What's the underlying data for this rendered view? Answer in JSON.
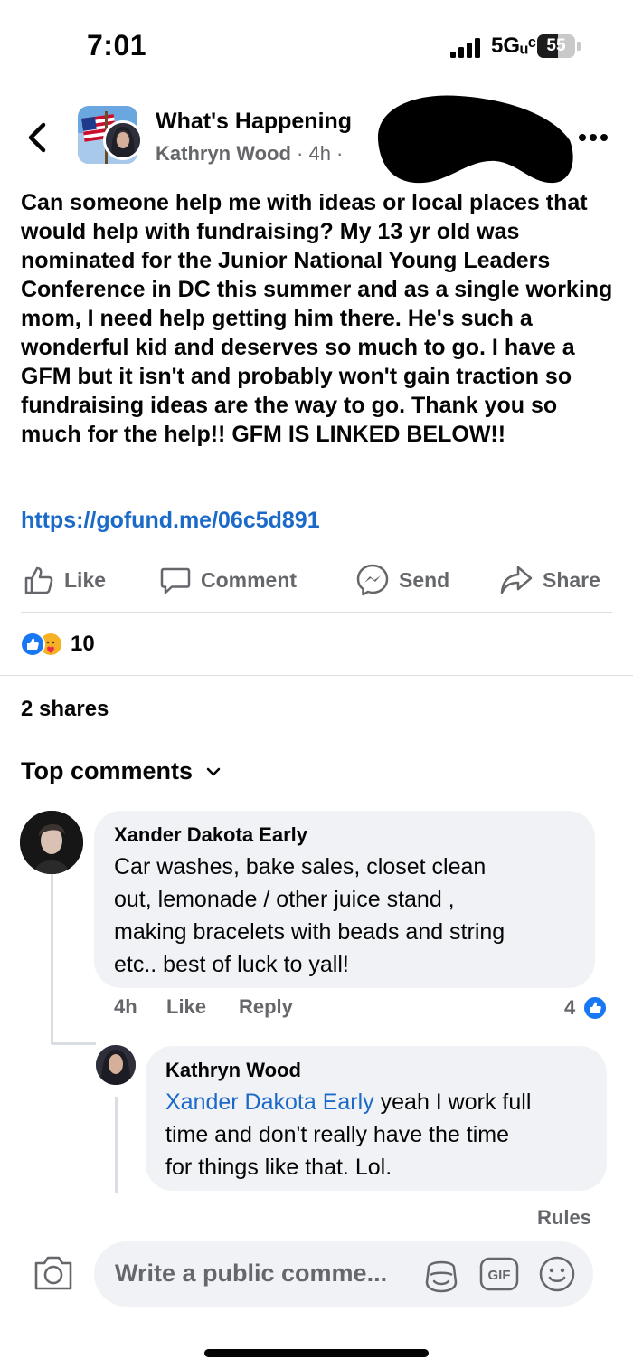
{
  "status_bar": {
    "time": "7:01",
    "network": "5Gᵤᶜ",
    "battery_percent": "55",
    "battery_level": 0.55
  },
  "post": {
    "group_name": "What's Happening",
    "author": "Kathryn Wood",
    "time_ago": " · 4h ·",
    "text": "Can someone help me with ideas or local places that would help with fundraising? My 13 yr old was nominated for the Junior National Young Leaders Conference in DC this summer and as a single working mom, I need help getting him there. He's such a wonderful kid and deserves so much to go. I have a GFM but it isn't and probably won't gain traction so fundraising ideas are the way to go. Thank you so much for the help!! GFM IS LINKED BELOW!!",
    "link": "https://gofund.me/06c5d891",
    "reaction_count": "10",
    "shares": "2 shares"
  },
  "actions": {
    "like": "Like",
    "comment": "Comment",
    "send": "Send",
    "share": "Share"
  },
  "comments_header": "Top comments",
  "comments": [
    {
      "author": "Xander Dakota Early",
      "text_lines": [
        "Car washes, bake sales, closet clean",
        "out, lemonade / other juice stand ,",
        "making bracelets with beads and string",
        "etc.. best of luck to yall!"
      ],
      "time": "4h",
      "like_label": "Like",
      "reply_label": "Reply",
      "likes": "4"
    },
    {
      "author": "Kathryn Wood",
      "mention": "Xander Dakota Early",
      "text_line1": " yeah I work full",
      "text_line2": "time and don't really have the time",
      "text_line3": "for things like that. Lol."
    }
  ],
  "composer": {
    "rules": "Rules",
    "placeholder": "Write a public comme..."
  },
  "colors": {
    "link_blue": "#1b6ac9",
    "like_blue": "#1877f2",
    "muted_text": "#65676b",
    "bubble_bg": "#f0f2f5"
  }
}
